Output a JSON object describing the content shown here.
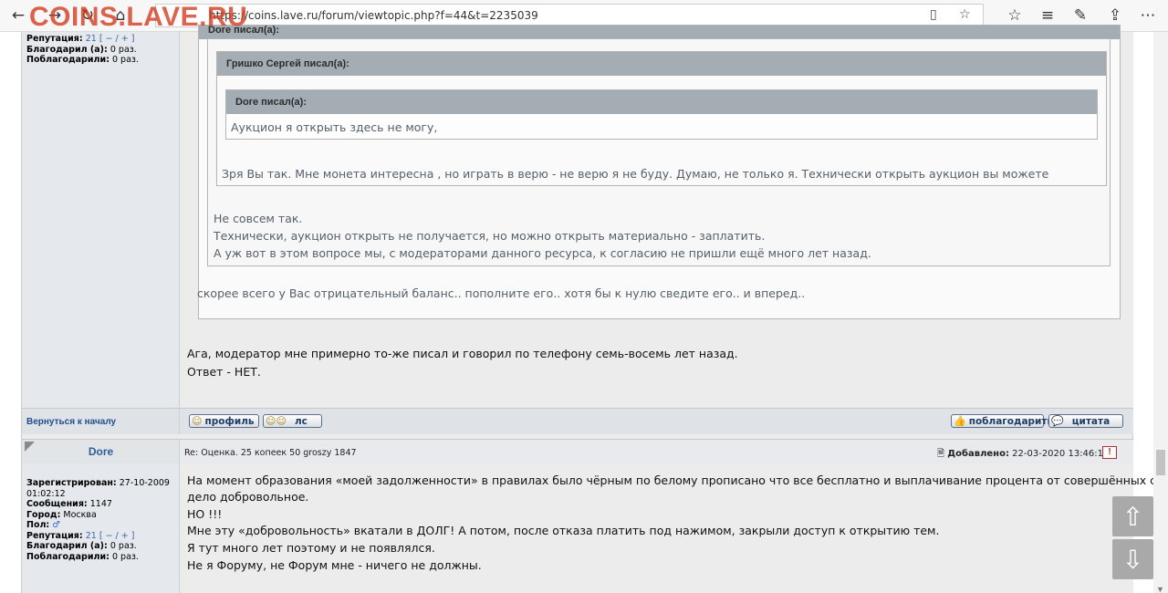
{
  "browser": {
    "watermark": "COINS.LAVE.RU",
    "url": "https://coins.lave.ru/forum/viewtopic.php?f=44&t=2235039"
  },
  "post1": {
    "stats": {
      "reputation_label": "Репутация:",
      "reputation_value": "21",
      "reputation_controls": "[ − / + ]",
      "thanked_label": "Благодарил (а):",
      "thanked_value": "0 раз.",
      "thanks_label": "Поблагодарили:",
      "thanks_value": "0 раз."
    },
    "quote_outer": {
      "header": "Dore писал(а):",
      "body": "скорее всего у Вас отрицательный баланс.. пополните его.. хотя бы к нулю сведите его.. и вперед.."
    },
    "quote_mid": {
      "lines": [
        "Не совсем так.",
        "Технически, аукцион открыть не получается, но можно открыть материально - заплатить.",
        "А уж вот в этом вопросе мы, с модераторами данного ресурса, к согласию не пришли ещё много лет назад."
      ]
    },
    "quote_grishko": {
      "header": "Гришко Сергей писал(а):",
      "body": "Зря Вы так. Мне монета интересна , но играть в верю - не верю я не буду. Думаю, не только я. Технически открыть аукцион вы можете"
    },
    "quote_dore_inner": {
      "header": "Dore писал(а):",
      "body": "Аукцион я открыть здесь не могу,"
    },
    "message_lines": [
      "Ага, модератор мне примерно то-же писал и говорил по телефону семь-восемь лет назад.",
      "Ответ - НЕТ."
    ],
    "back_to_top": "Вернуться к началу",
    "buttons": {
      "profile": "профиль",
      "pm": "лс",
      "thank": "поблагодарить",
      "quote": "цитата"
    }
  },
  "post2": {
    "author": "Dore",
    "subject": "Re: Оценка. 25 копеек 50 groszy 1847",
    "added_label": "Добавлено:",
    "added_value": "22-03-2020 13:46:18",
    "stats": {
      "registered_label": "Зарегистрирован:",
      "registered_value": "27-10-2009 01:02:12",
      "posts_label": "Сообщения:",
      "posts_value": "1147",
      "city_label": "Город:",
      "city_value": "Москва",
      "gender_label": "Пол:",
      "reputation_label": "Репутация:",
      "reputation_value": "21",
      "reputation_controls": "[ − / + ]",
      "thanked_label": "Благодарил (а):",
      "thanked_value": "0 раз.",
      "thanks_label": "Поблагодарили:",
      "thanks_value": "0 раз."
    },
    "message_lines": [
      "На момент образования «моей задолженности» в правилах было чёрным по белому прописано что все бесплатно и выплачивание процента от совершённых сделок",
      "дело добровольное.",
      "НО !!!",
      "Мне эту «добровольность» вкатали в ДОЛГ! А потом, после отказа платить под нажимом, закрыли доступ к открытию тем.",
      "Я тут много лет поэтому и не появлялся.",
      "Не я Форуму, не Форум мне - ничего не должны."
    ]
  },
  "side_nav": {
    "up": "⇧",
    "down": "⇩"
  }
}
